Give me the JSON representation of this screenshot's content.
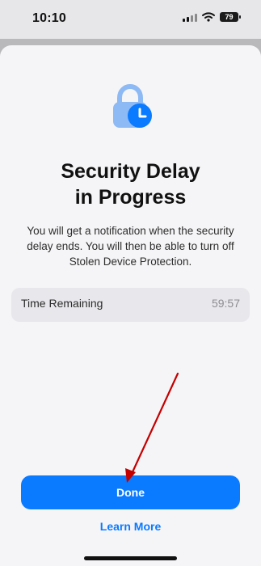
{
  "status_bar": {
    "time": "10:10",
    "battery": "79"
  },
  "sheet": {
    "title_line_1": "Security Delay",
    "title_line_2": "in Progress",
    "description": "You will get a notification when the security delay ends. You will then be able to turn off Stolen Device Protection.",
    "time_remaining_label": "Time Remaining",
    "time_remaining_value": "59:57",
    "done_label": "Done",
    "learn_more_label": "Learn More"
  },
  "icons": {
    "lock": "lock-clock-icon",
    "signal": "cellular-signal-icon",
    "wifi": "wifi-icon",
    "battery": "battery-icon"
  },
  "colors": {
    "accent": "#0A7AFF",
    "lock": "#8DB9F4",
    "arrow": "#C50000"
  }
}
